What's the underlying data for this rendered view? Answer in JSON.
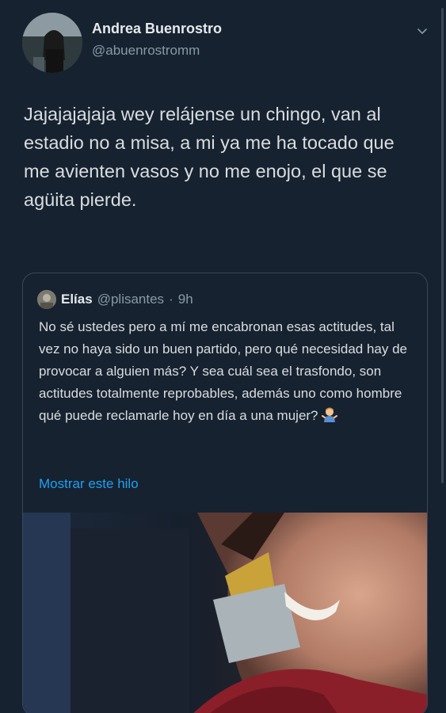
{
  "tweet": {
    "author_name": "Andrea Buenrostro",
    "author_handle": "@abuenrostromm",
    "text": "Jajajajajaja wey relájense un chingo, van al estadio no a misa, a mi ya me ha tocado que me avienten vasos y no me enojo, el que se agüita pierde."
  },
  "quote": {
    "name": "Elías",
    "handle": "@plisantes",
    "separator": "·",
    "time": "9h",
    "text": "No sé ustedes pero a mí me encabronan esas actitudes, tal vez no haya sido un buen partido, pero qué necesidad hay de provocar a alguien más? Y sea cuál sea el trasfondo, son actitudes totalmente reprobables, además uno como hombre qué puede reclamarle hoy en día a una mujer?",
    "emoji": "man-shrugging-icon",
    "show_thread": "Mostrar este hilo"
  },
  "colors": {
    "background": "#15202b",
    "text": "#d9dde1",
    "secondary": "#8899a6",
    "link": "#1da1f2"
  },
  "icons": {
    "menu": "chevron-down-icon"
  }
}
